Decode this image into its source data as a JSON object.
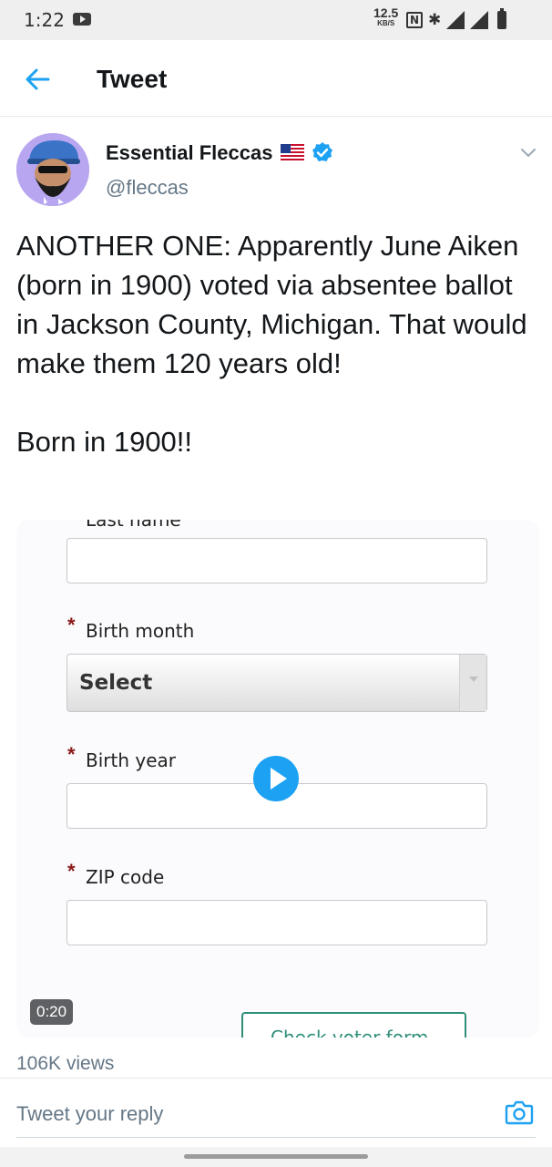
{
  "status_bar": {
    "time": "1:22",
    "speed_value": "12.5",
    "speed_unit": "KB/S",
    "icons": [
      "youtube-icon",
      "nfc-icon",
      "bluetooth-icon",
      "4g-signal-icon",
      "signal-icon",
      "battery-icon"
    ]
  },
  "header": {
    "title": "Tweet",
    "back_icon": "arrow-left-icon"
  },
  "author": {
    "name": "Essential Fleccas",
    "handle": "@fleccas",
    "verified": true,
    "flag": "us-flag-icon"
  },
  "tweet": {
    "paragraph_1": "ANOTHER ONE: Apparently June Aiken (born in 1900) voted via absentee ballot in Jackson County, Michigan. That would make them 120 years old!",
    "paragraph_2": "Born in 1900!!"
  },
  "media": {
    "cut_label": "Last name",
    "required_marker": "*",
    "birth_month_label": "Birth month",
    "select_value": "Select",
    "birth_year_label": "Birth year",
    "zip_label": "ZIP code",
    "duration": "0:20",
    "partial_button_label": "Check voter form"
  },
  "stats": {
    "views": "106K views"
  },
  "reply": {
    "placeholder": "Tweet your reply"
  },
  "colors": {
    "accent": "#1da1f2",
    "text_primary": "#14171a",
    "text_secondary": "#657786",
    "required": "#8b1a1a"
  }
}
